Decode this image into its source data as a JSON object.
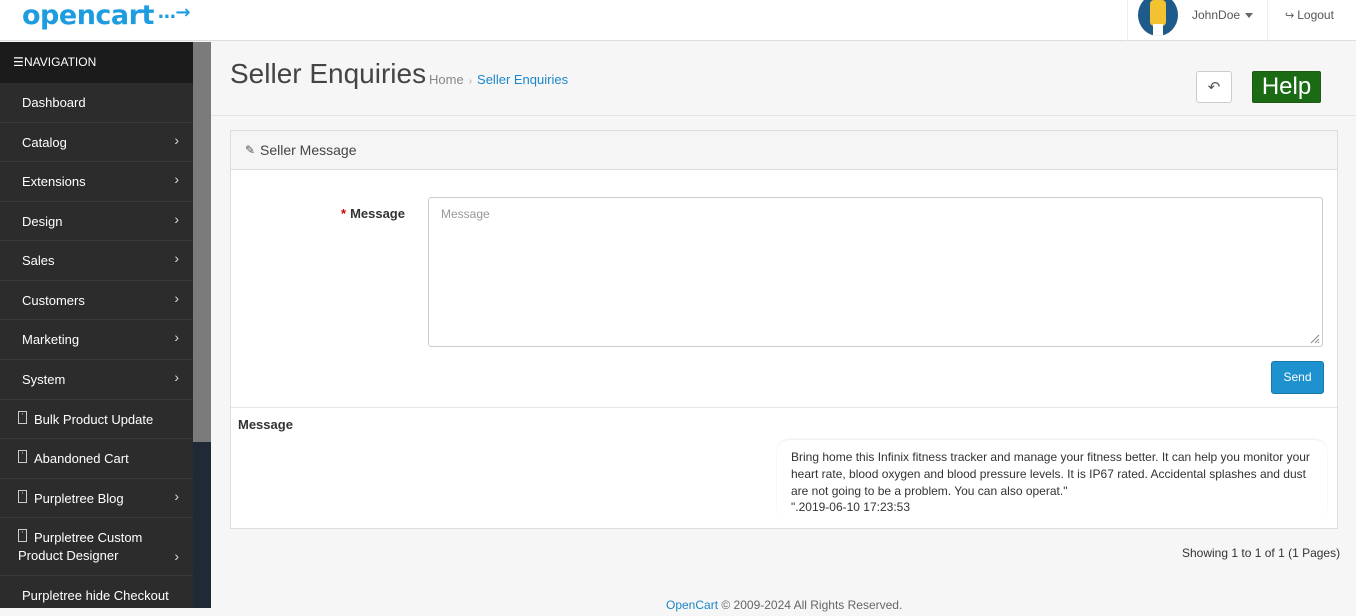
{
  "brand": {
    "logo_text": "opencart",
    "logo_glyph": "˙→"
  },
  "header": {
    "username": "JohnDoe",
    "logout": "Logout",
    "logout_icon": "sign-out-icon"
  },
  "sidebar": {
    "nav_heading": "NAVIGATION",
    "items": [
      {
        "label": "Dashboard",
        "chevron": false
      },
      {
        "label": "Catalog",
        "chevron": true
      },
      {
        "label": "Extensions",
        "chevron": true
      },
      {
        "label": "Design",
        "chevron": true
      },
      {
        "label": "Sales",
        "chevron": true
      },
      {
        "label": "Customers",
        "chevron": true
      },
      {
        "label": "Marketing",
        "chevron": true
      },
      {
        "label": "System",
        "chevron": true
      },
      {
        "label": "Bulk Product Update",
        "chevron": false
      },
      {
        "label": "Abandoned Cart",
        "chevron": false
      },
      {
        "label": "Purpletree Blog",
        "chevron": true
      },
      {
        "label": "Purpletree Custom",
        "label2": "Product Designer",
        "chevron": true
      },
      {
        "label": "Purpletree hide Checkout",
        "chevron": false
      }
    ]
  },
  "page": {
    "title": "Seller Enquiries",
    "breadcrumb": [
      "Home",
      "Seller Enquiries"
    ],
    "help_label": "Help"
  },
  "panel": {
    "title": "Seller Message",
    "form": {
      "message_label": "Message",
      "message_value": "",
      "message_placeholder": "Message",
      "send_label": "Send"
    },
    "messages_heading": "Message",
    "messages": [
      {
        "text": "Bring home this Infinix fitness tracker and manage your fitness better. It can help you monitor your heart rate, blood oxygen and blood pressure levels. It is IP67 rated. Accidental splashes and dust are not going to be a problem. You can also operat.\"",
        "date": "\".2019-06-10 17:23:53"
      }
    ]
  },
  "pagination": {
    "text": "Showing 1 to 1 of 1 (1 Pages)"
  },
  "footer": {
    "link": "OpenCart",
    "text": " © 2009-2024 All Rights Reserved."
  },
  "colors": {
    "accent": "#1e91cf",
    "help": "#1b6b14",
    "sidebar": "#2c2c2c"
  }
}
